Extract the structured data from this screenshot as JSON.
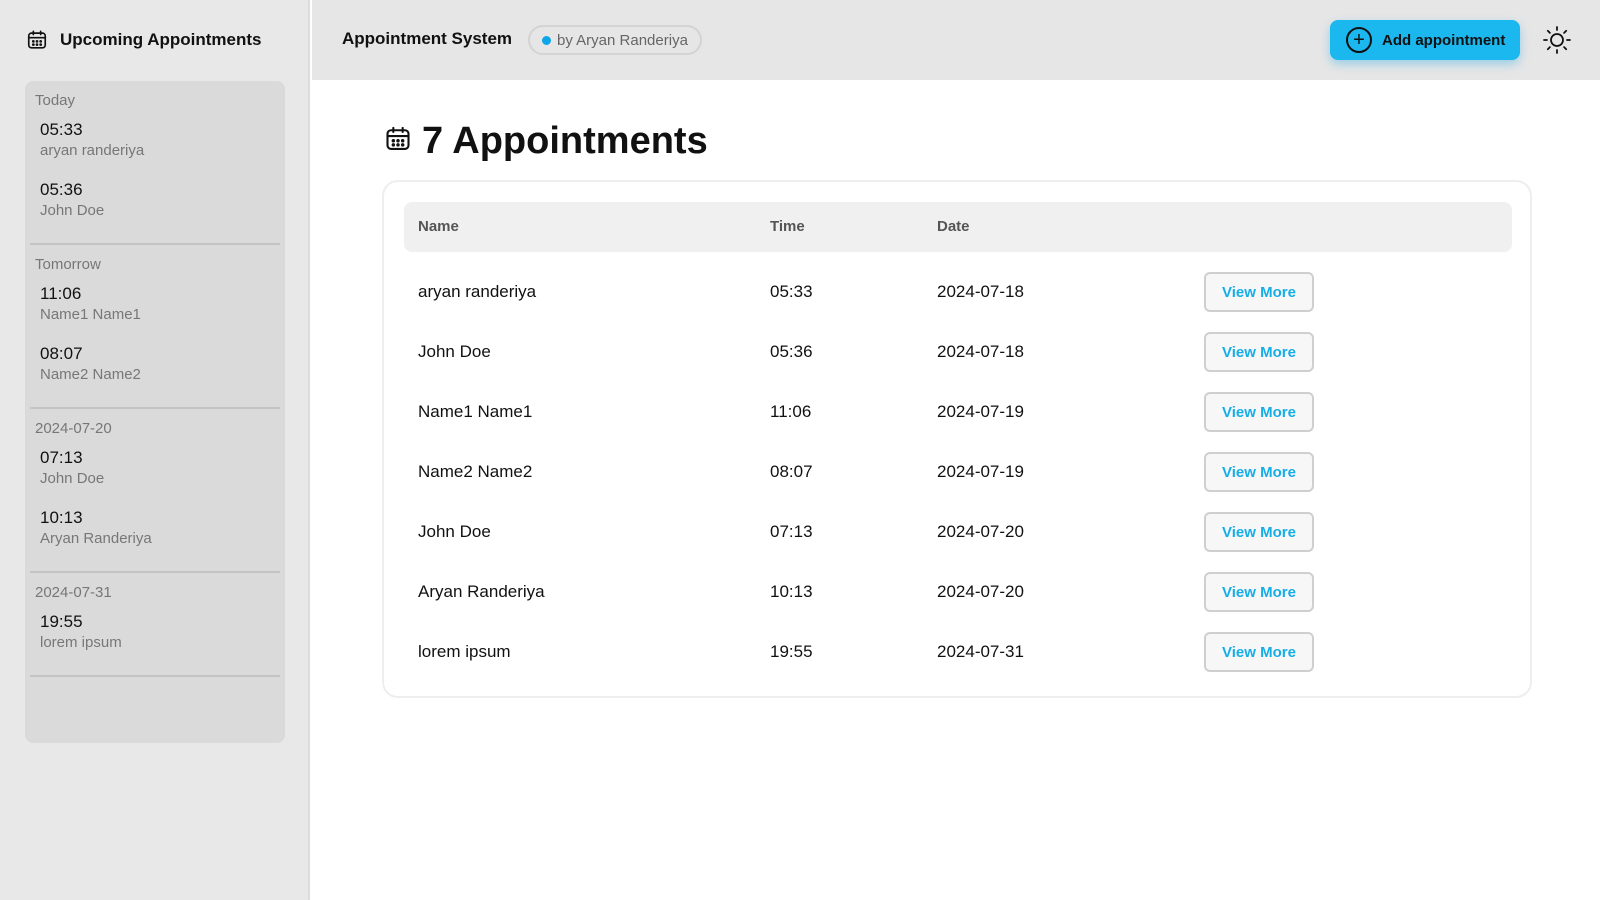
{
  "sidebar": {
    "title": "Upcoming Appointments",
    "groups": [
      {
        "label": "Today",
        "entries": [
          {
            "time": "05:33",
            "name": "aryan randeriya"
          },
          {
            "time": "05:36",
            "name": "John Doe"
          }
        ]
      },
      {
        "label": "Tomorrow",
        "entries": [
          {
            "time": "11:06",
            "name": "Name1 Name1"
          },
          {
            "time": "08:07",
            "name": "Name2 Name2"
          }
        ]
      },
      {
        "label": "2024-07-20",
        "entries": [
          {
            "time": "07:13",
            "name": "John Doe"
          },
          {
            "time": "10:13",
            "name": "Aryan Randeriya"
          }
        ]
      },
      {
        "label": "2024-07-31",
        "entries": [
          {
            "time": "19:55",
            "name": "lorem ipsum"
          }
        ]
      }
    ]
  },
  "header": {
    "app_title": "Appointment System",
    "author_badge": "by Aryan Randeriya",
    "add_button_label": "Add appointment"
  },
  "main": {
    "heading": "7 Appointments",
    "columns": {
      "name": "Name",
      "time": "Time",
      "date": "Date"
    },
    "view_more_label": "View More",
    "rows": [
      {
        "name": "aryan randeriya",
        "time": "05:33",
        "date": "2024-07-18"
      },
      {
        "name": "John Doe",
        "time": "05:36",
        "date": "2024-07-18"
      },
      {
        "name": "Name1 Name1",
        "time": "11:06",
        "date": "2024-07-19"
      },
      {
        "name": "Name2 Name2",
        "time": "08:07",
        "date": "2024-07-19"
      },
      {
        "name": "John Doe",
        "time": "07:13",
        "date": "2024-07-20"
      },
      {
        "name": "Aryan Randeriya",
        "time": "10:13",
        "date": "2024-07-20"
      },
      {
        "name": "lorem ipsum",
        "time": "19:55",
        "date": "2024-07-31"
      }
    ]
  },
  "colors": {
    "accent": "#1bb7ef",
    "link": "#16aee6",
    "status_dot": "#0ea5e9"
  },
  "icons": {
    "sidebar_header": "calendar-icon",
    "main_heading": "calendar-icon",
    "add_button": "plus-circle-icon",
    "theme_toggle": "sun-icon"
  }
}
